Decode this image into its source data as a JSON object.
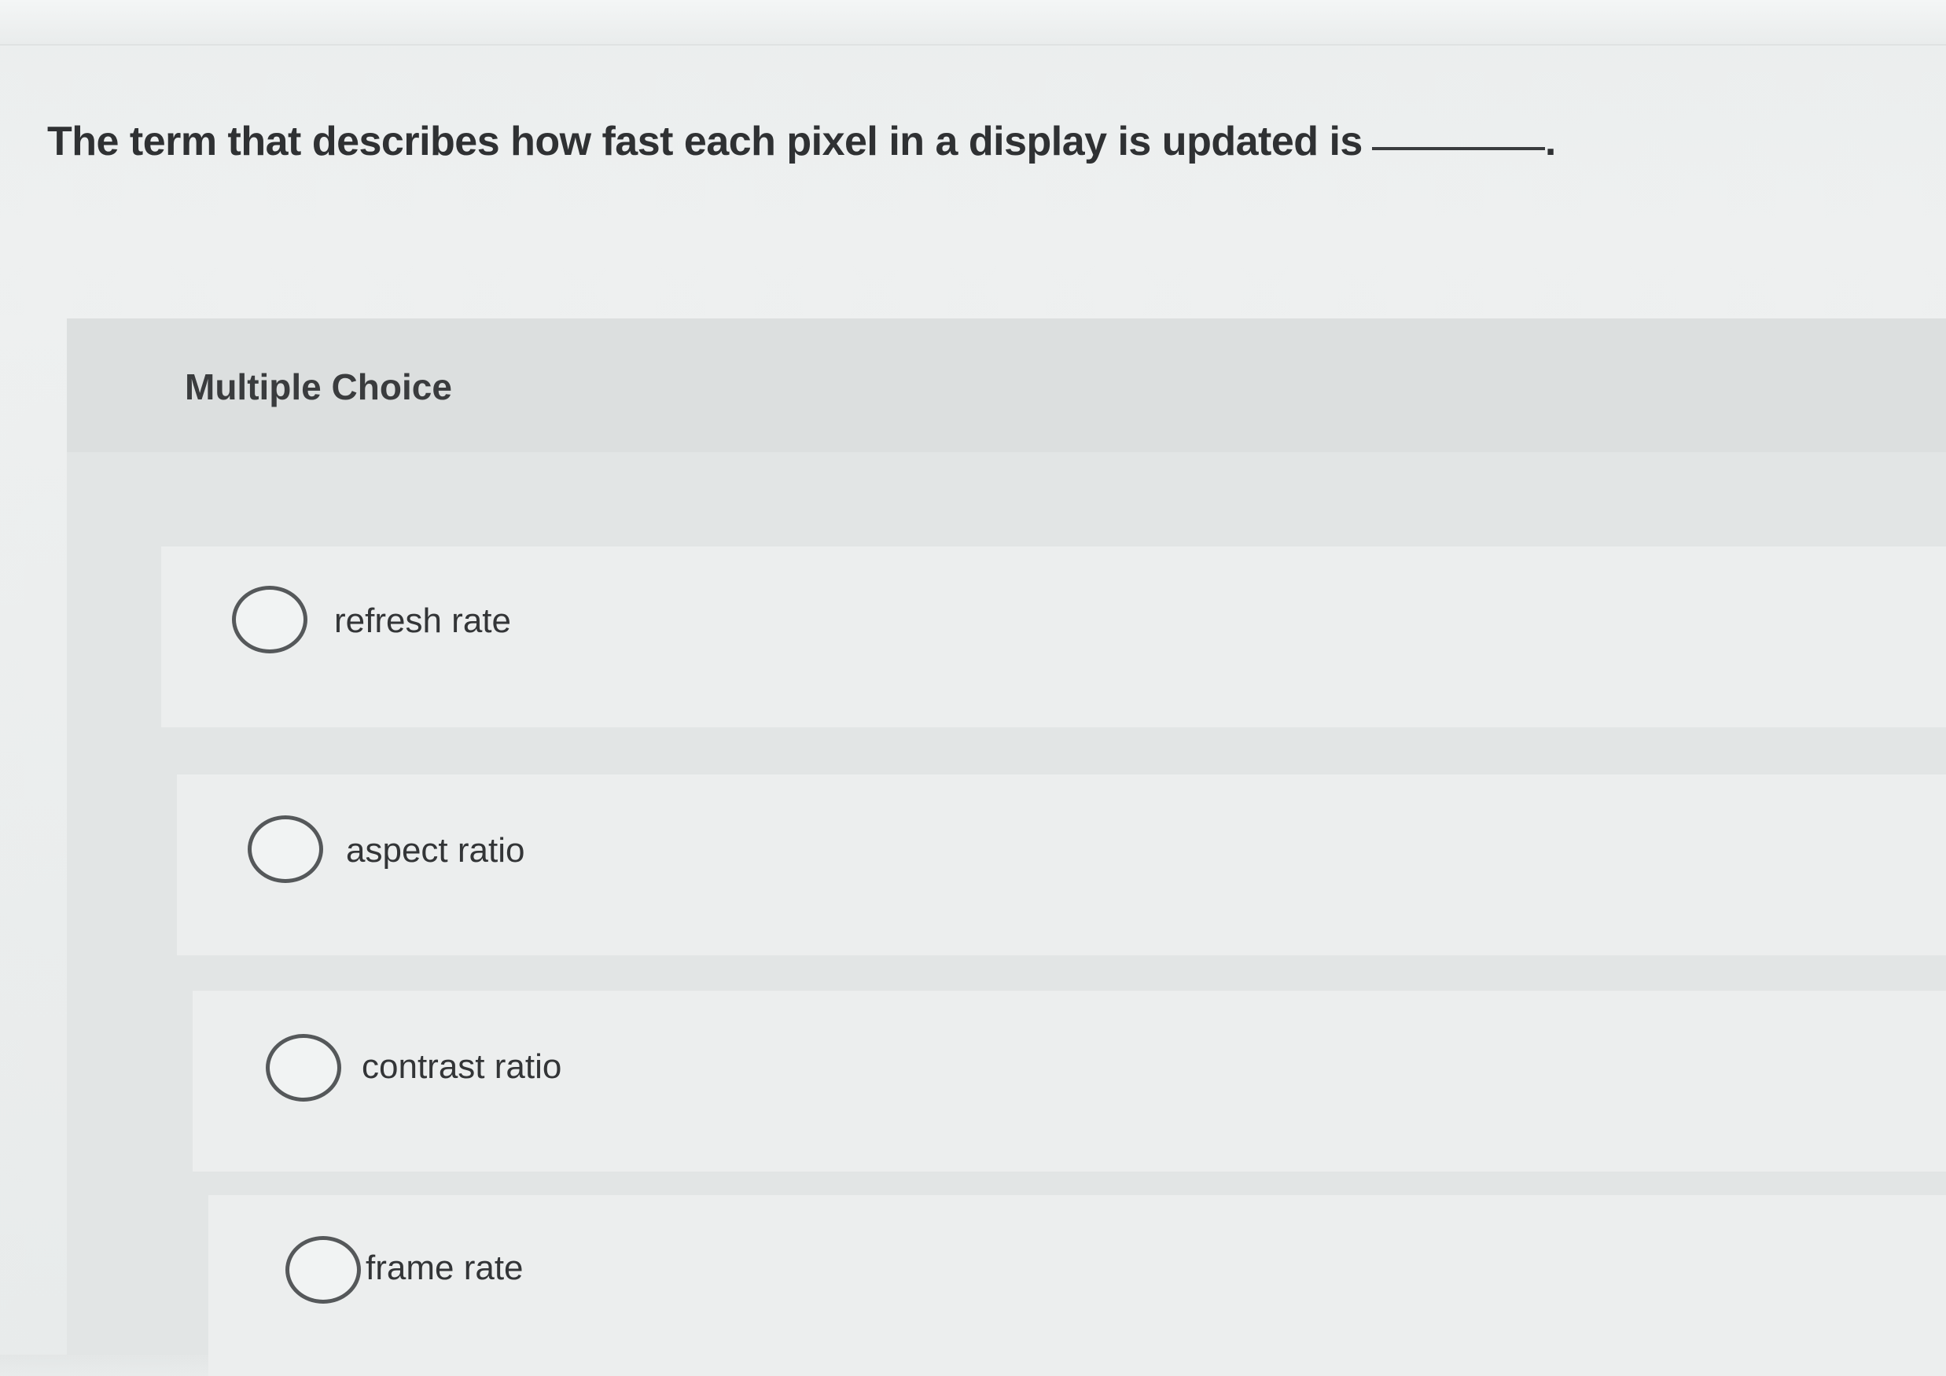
{
  "question": {
    "text": "The term that describes how fast each pixel in a display is updated is",
    "ending": "."
  },
  "answer_panel": {
    "label": "Multiple Choice",
    "choices": [
      {
        "label": "refresh rate",
        "selected": false
      },
      {
        "label": "aspect ratio",
        "selected": false
      },
      {
        "label": "contrast ratio",
        "selected": false
      },
      {
        "label": "frame rate",
        "selected": false
      }
    ]
  }
}
